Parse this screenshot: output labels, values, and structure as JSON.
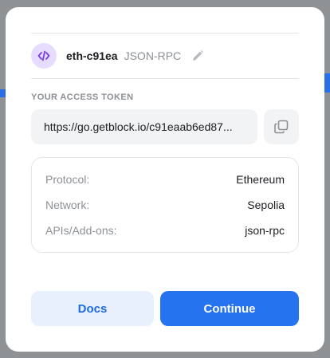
{
  "endpoint": {
    "name": "eth-c91ea",
    "type": "JSON-RPC",
    "icon": "code-icon",
    "icon_color": "#7b3fe4"
  },
  "token": {
    "label": "YOUR ACCESS TOKEN",
    "value": "https://go.getblock.io/c91eaab6ed87..."
  },
  "details": [
    {
      "label": "Protocol:",
      "value": "Ethereum"
    },
    {
      "label": "Network:",
      "value": "Sepolia"
    },
    {
      "label": "APIs/Add-ons:",
      "value": "json-rpc"
    }
  ],
  "actions": {
    "docs_label": "Docs",
    "continue_label": "Continue"
  },
  "colors": {
    "primary": "#2573ee",
    "primary_soft": "#e8f0fd",
    "accent_purple": "#7b3fe4"
  }
}
